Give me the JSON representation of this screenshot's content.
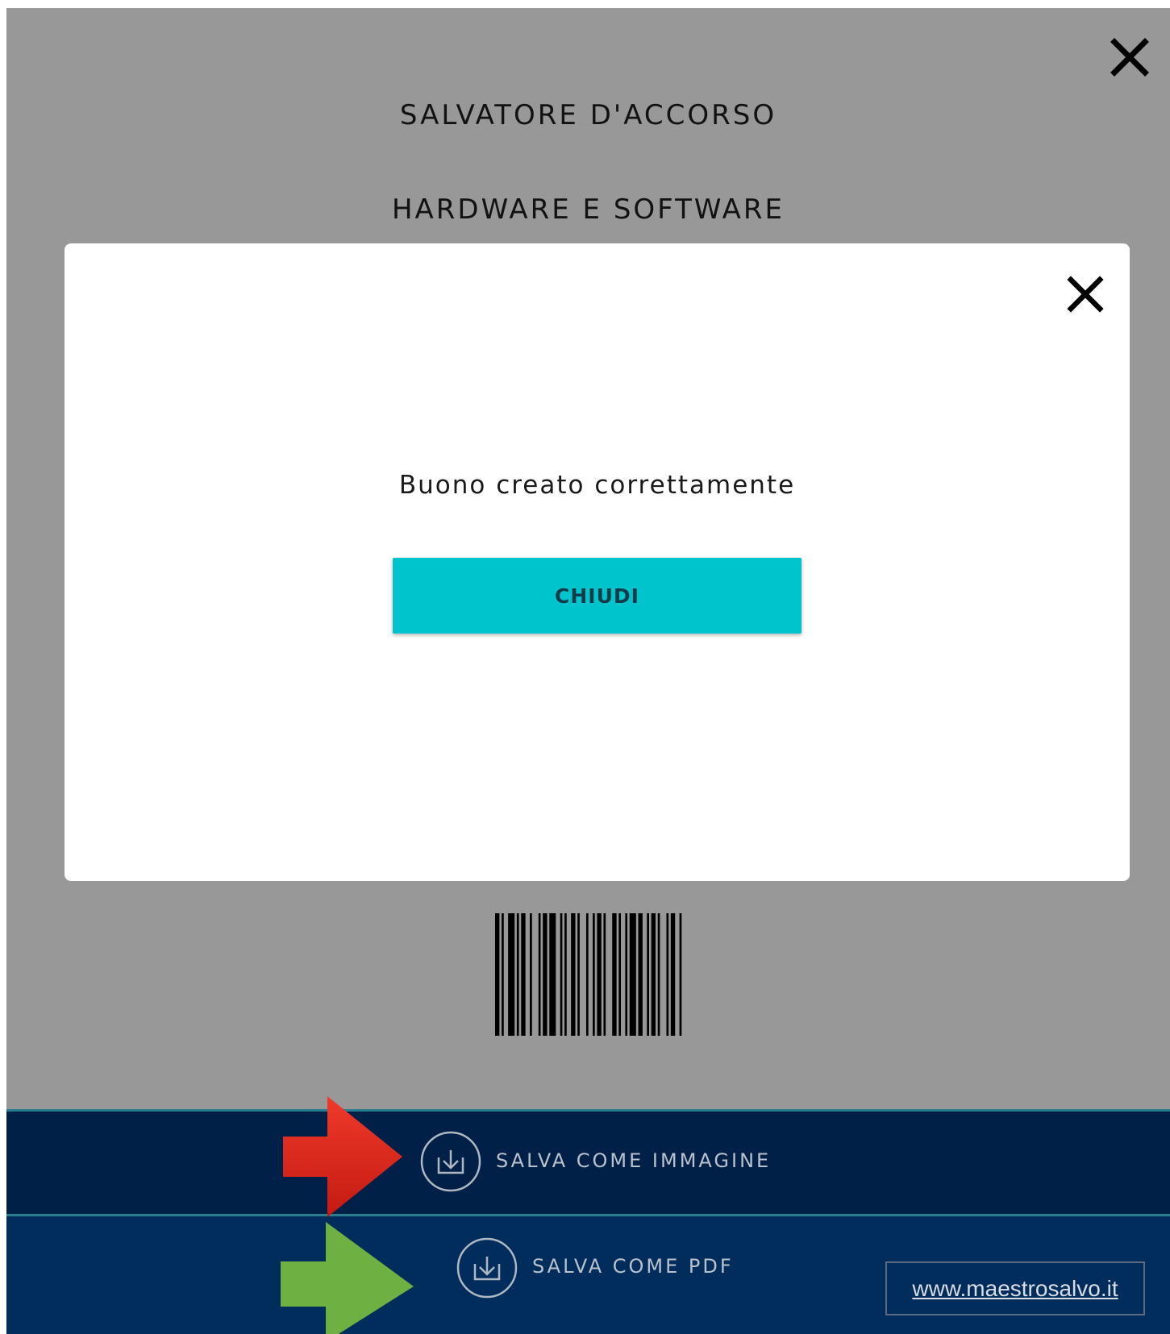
{
  "header": {
    "owner_name": "SALVATORE D'ACCORSO",
    "category": "HARDWARE E SOFTWARE"
  },
  "icons": {
    "close": "close-icon",
    "download": "download-icon",
    "barcode": "barcode"
  },
  "modal": {
    "message": "Buono creato correttamente",
    "close_button_label": "CHIUDI",
    "button_color": "#00c4cc"
  },
  "actions": {
    "save_image_label": "SALVA COME IMMAGINE",
    "save_pdf_label": "SALVA COME PDF"
  },
  "annotations": {
    "red_arrow_color": "#e0281f",
    "green_arrow_color": "#6fb043"
  },
  "watermark": "www.maestrosalvo.it"
}
